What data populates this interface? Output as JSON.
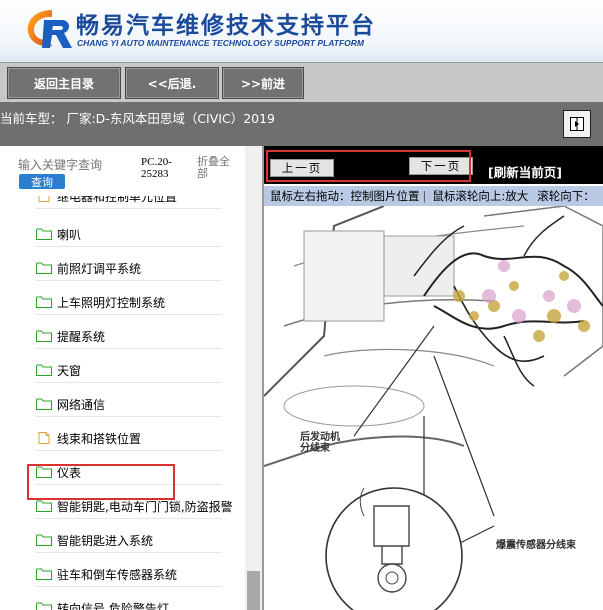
{
  "header": {
    "title": "畅易汽车维修技术支持平台",
    "subtitle": "CHANG YI AUTO MAINTENANCE TECHNOLOGY SUPPORT PLATFORM",
    "logo_icon": "cy-logo-icon",
    "brand_color": "#1b4a9c"
  },
  "toolbar": {
    "home_label": "返回主目录",
    "back_label": "<<后退.",
    "forward_label": ">>前进"
  },
  "vehicle": {
    "label": "当前车型：  厂家:D-东风本田思域（CIVIC）2019"
  },
  "search": {
    "placeholder": "输入关键字查询",
    "button_label": "查询",
    "pc_code": "PC.20-25283",
    "collapse_label": "折叠全部"
  },
  "tree": {
    "partial_item": "继电器和控制单元位置",
    "items": [
      {
        "label": "喇叭",
        "icon": "folder-icon"
      },
      {
        "label": "前照灯调平系统",
        "icon": "folder-icon"
      },
      {
        "label": "上车照明灯控制系统",
        "icon": "folder-icon"
      },
      {
        "label": "提醒系统",
        "icon": "folder-icon"
      },
      {
        "label": "天窗",
        "icon": "folder-icon"
      },
      {
        "label": "网络通信",
        "icon": "folder-icon"
      },
      {
        "label": "线束和搭铁位置",
        "icon": "document-icon",
        "selected": true
      },
      {
        "label": "仪表",
        "icon": "folder-icon"
      },
      {
        "label": "智能钥匙,电动车门门锁,防盗报警",
        "icon": "folder-icon"
      },
      {
        "label": "智能钥匙进入系统",
        "icon": "folder-icon"
      },
      {
        "label": "驻车和倒车传感器系统",
        "icon": "folder-icon"
      },
      {
        "label": "转向信号 危险警告灯",
        "icon": "folder-icon"
      }
    ]
  },
  "viewer": {
    "prev_label": "上一页",
    "next_label": "下一页",
    "refresh_label": "[刷新当前页]",
    "hints": [
      "鼠标左右拖动：控制图片位置",
      "鼠标滚轮向上:放大",
      "滚轮向下："
    ],
    "callout_1": "后发动机\n分线束",
    "callout_2": "爆震传感器分线束"
  },
  "colors": {
    "highlight": "#d93030",
    "toolbar_button": "#727272",
    "search_button": "#2b7fcf",
    "hint_bar": "#b9c9e4"
  }
}
